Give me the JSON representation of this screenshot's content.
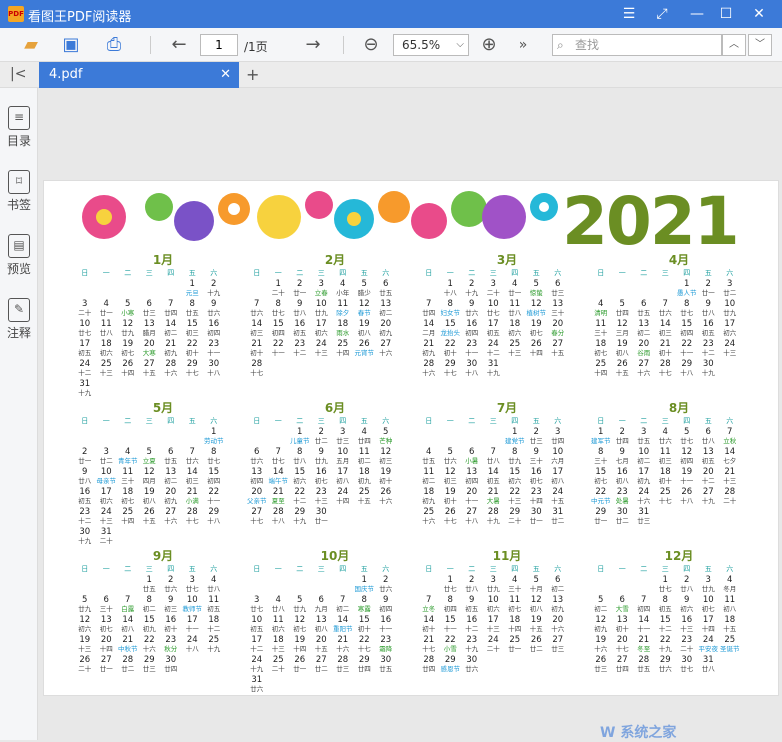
{
  "app": {
    "title": "看图王PDF阅读器",
    "logo_text": "PDF"
  },
  "toolbar": {
    "page_current": "1",
    "page_total": "/1页",
    "zoom": "65.5%",
    "search_placeholder": "查找"
  },
  "tab": {
    "name": "4.pdf"
  },
  "sidebar": [
    {
      "label": "目录",
      "icon": "list-icon"
    },
    {
      "label": "书签",
      "icon": "bookmark-icon"
    },
    {
      "label": "预览",
      "icon": "preview-icon"
    },
    {
      "label": "注释",
      "icon": "note-icon"
    }
  ],
  "calendar": {
    "year": "2021",
    "weekdays": [
      "日",
      "一",
      "二",
      "三",
      "四",
      "五",
      "六"
    ],
    "months": [
      {
        "title": "1月",
        "start": 5,
        "days": 31,
        "lunar": [
          "元旦",
          "十九",
          "二十",
          "廿一",
          "小寒",
          "廿三",
          "廿四",
          "廿五",
          "廿六",
          "廿七",
          "廿八",
          "廿九",
          "腊月",
          "初二",
          "初三",
          "初四",
          "初五",
          "初六",
          "初七",
          "大寒",
          "初九",
          "初十",
          "十一",
          "十二",
          "十三",
          "十四",
          "十五",
          "十六",
          "十七",
          "十八",
          "十九"
        ]
      },
      {
        "title": "2月",
        "start": 1,
        "days": 28,
        "lunar": [
          "二十",
          "廿一",
          "立春",
          "小年",
          "腊少",
          "廿五",
          "廿六",
          "廿七",
          "廿八",
          "廿九",
          "除夕",
          "春节",
          "初二",
          "初三",
          "初四",
          "初五",
          "初六",
          "雨水",
          "初八",
          "初九",
          "初十",
          "十一",
          "十二",
          "十三",
          "十四",
          "元宵节",
          "十六",
          "十七"
        ]
      },
      {
        "title": "3月",
        "start": 1,
        "days": 31,
        "lunar": [
          "十八",
          "十九",
          "二十",
          "廿一",
          "惊蛰",
          "廿三",
          "廿四",
          "妇女节",
          "廿六",
          "廿七",
          "廿八",
          "植树节",
          "三十",
          "二月",
          "龙抬头",
          "初四",
          "初五",
          "初六",
          "初七",
          "春分",
          "初九",
          "初十",
          "十一",
          "十二",
          "十三",
          "十四",
          "十五",
          "十六",
          "十七",
          "十八",
          "十九"
        ]
      },
      {
        "title": "4月",
        "start": 4,
        "days": 30,
        "lunar": [
          "愚人节",
          "廿一",
          "廿二",
          "清明",
          "廿四",
          "廿五",
          "廿六",
          "廿七",
          "廿八",
          "廿九",
          "三十",
          "三月",
          "初二",
          "初三",
          "初四",
          "初五",
          "初六",
          "初七",
          "初八",
          "谷雨",
          "初十",
          "十一",
          "十二",
          "十三",
          "十四",
          "十五",
          "十六",
          "十七",
          "十八",
          "十九"
        ]
      },
      {
        "title": "5月",
        "start": 6,
        "days": 31,
        "lunar": [
          "劳动节",
          "廿一",
          "廿二",
          "青年节",
          "立夏",
          "廿五",
          "廿六",
          "廿七",
          "廿八",
          "母亲节",
          "三十",
          "四月",
          "初二",
          "初三",
          "初四",
          "初五",
          "初六",
          "初七",
          "初八",
          "初九",
          "小满",
          "十一",
          "十二",
          "十三",
          "十四",
          "十五",
          "十六",
          "十七",
          "十八",
          "十九",
          "二十"
        ]
      },
      {
        "title": "6月",
        "start": 2,
        "days": 30,
        "lunar": [
          "儿童节",
          "廿二",
          "廿三",
          "廿四",
          "芒种",
          "廿六",
          "廿七",
          "廿八",
          "廿九",
          "五月",
          "初二",
          "初三",
          "初四",
          "端午节",
          "初六",
          "初七",
          "初八",
          "初九",
          "初十",
          "父亲节",
          "夏至",
          "十二",
          "十三",
          "十四",
          "十五",
          "十六",
          "十七",
          "十八",
          "十九",
          "廿一"
        ]
      },
      {
        "title": "7月",
        "start": 4,
        "days": 31,
        "lunar": [
          "建党节",
          "廿三",
          "廿四",
          "廿五",
          "廿六",
          "小暑",
          "廿八",
          "廿九",
          "三十",
          "六月",
          "初二",
          "初三",
          "初四",
          "初五",
          "初六",
          "初七",
          "初八",
          "初九",
          "初十",
          "十一",
          "大暑",
          "十三",
          "十四",
          "十五",
          "十六",
          "十七",
          "十八",
          "十九",
          "二十",
          "廿一",
          "廿二"
        ]
      },
      {
        "title": "8月",
        "start": 0,
        "days": 31,
        "lunar": [
          "建军节",
          "廿四",
          "廿五",
          "廿六",
          "廿七",
          "廿八",
          "立秋",
          "三十",
          "七月",
          "初二",
          "初三",
          "初四",
          "初五",
          "七夕",
          "初七",
          "初八",
          "初九",
          "初十",
          "十一",
          "十二",
          "十三",
          "中元节",
          "处暑",
          "十六",
          "十七",
          "十八",
          "十九",
          "二十",
          "廿一",
          "廿二",
          "廿三"
        ]
      },
      {
        "title": "9月",
        "start": 3,
        "days": 30,
        "lunar": [
          "廿五",
          "廿六",
          "廿七",
          "廿八",
          "廿九",
          "三十",
          "白露",
          "初二",
          "初三",
          "教师节",
          "初五",
          "初六",
          "初七",
          "初八",
          "初九",
          "初十",
          "十一",
          "十二",
          "十三",
          "十四",
          "中秋节",
          "十六",
          "秋分",
          "十八",
          "十九",
          "二十",
          "廿一",
          "廿二",
          "廿三",
          "廿四"
        ]
      },
      {
        "title": "10月",
        "start": 5,
        "days": 31,
        "lunar": [
          "国庆节",
          "廿六",
          "廿七",
          "廿八",
          "廿九",
          "九月",
          "初二",
          "寒露",
          "初四",
          "初五",
          "初六",
          "初七",
          "初八",
          "重阳节",
          "初十",
          "十一",
          "十二",
          "十三",
          "十四",
          "十五",
          "十六",
          "十七",
          "霜降",
          "十九",
          "二十",
          "廿一",
          "廿二",
          "廿三",
          "廿四",
          "廿五",
          "廿六"
        ]
      },
      {
        "title": "11月",
        "start": 1,
        "days": 30,
        "lunar": [
          "廿七",
          "廿八",
          "廿九",
          "三十",
          "十月",
          "初二",
          "立冬",
          "初四",
          "初五",
          "初六",
          "初七",
          "初八",
          "初九",
          "初十",
          "十一",
          "十二",
          "十三",
          "十四",
          "十五",
          "十六",
          "十七",
          "小雪",
          "十九",
          "二十",
          "廿一",
          "廿二",
          "廿三",
          "廿四",
          "感恩节",
          "廿六"
        ]
      },
      {
        "title": "12月",
        "start": 3,
        "days": 31,
        "lunar": [
          "廿七",
          "廿八",
          "廿九",
          "冬月",
          "初二",
          "大雪",
          "初四",
          "初五",
          "初六",
          "初七",
          "初八",
          "初九",
          "初十",
          "十一",
          "十二",
          "十三",
          "十四",
          "十五",
          "十六",
          "十七",
          "冬至",
          "十九",
          "二十",
          "平安夜",
          "圣诞节",
          "廿三",
          "廿四",
          "廿五",
          "廿六",
          "廿七",
          "廿八"
        ]
      }
    ]
  },
  "watermark": "W 系统之家"
}
